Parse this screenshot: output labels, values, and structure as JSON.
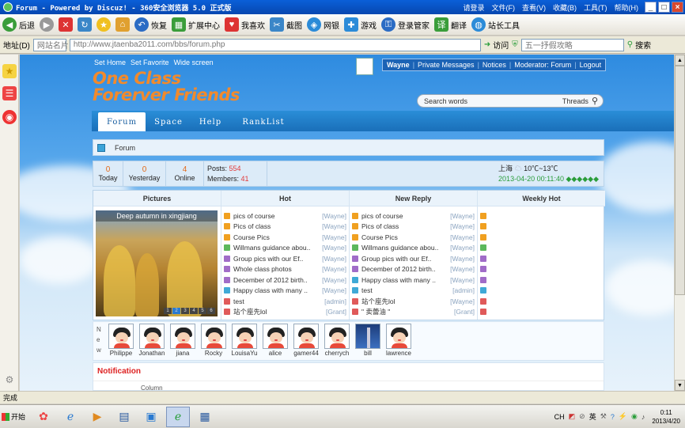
{
  "window": {
    "title": "Forum - Powered by Discuz! - 360安全浏览器 5.0 正式版",
    "menus": [
      "请登录",
      "文件(F)",
      "查看(V)",
      "收藏(B)",
      "工具(T)",
      "帮助(H)"
    ],
    "controls": {
      "minimize": "_",
      "maximize": "□",
      "close": "×"
    }
  },
  "toolbar": {
    "back": "后退",
    "restore": "恢复",
    "extensions": "扩展中心",
    "favorites_like": "我喜欢",
    "screenshot": "截图",
    "netbank": "网银",
    "games": "游戏",
    "login_manager": "登录管家",
    "translate": "翻译",
    "webmaster": "站长工具"
  },
  "address": {
    "label": "地址(D)",
    "site_name": "网站名片",
    "url": "http://www.jtaenba2011.com/bbs/forum.php",
    "go": "访问",
    "search_placeholder": "五一抒假攻略",
    "search_btn": "搜索"
  },
  "site": {
    "top_links": [
      "Set Home",
      "Set Favorite",
      "Wide screen"
    ],
    "brand_line1": "One Class",
    "brand_line2": "Forerver Friends",
    "user": {
      "name": "Wayne",
      "links": [
        "Private Messages",
        "Notices",
        "Moderator: Forum",
        "Logout"
      ]
    },
    "search": {
      "placeholder": "Search words",
      "scope": "Threads"
    },
    "nav": [
      "Forum",
      "Space",
      "Help",
      "RankList"
    ],
    "breadcrumb": "Forum"
  },
  "stats": {
    "today": {
      "value": "0",
      "label": "Today"
    },
    "yesterday": {
      "value": "0",
      "label": "Yesterday"
    },
    "online": {
      "value": "4",
      "label": "Online"
    },
    "posts_label": "Posts:",
    "posts": "554",
    "members_label": "Members:",
    "members": "41",
    "city": "上海",
    "temperature": "10℃~13℃",
    "datetime": "2013-04-20 00:11:40",
    "stars": "◆◆◆◆◆◆"
  },
  "columns": {
    "pictures": "Pictures",
    "hot": "Hot",
    "new_reply": "New Reply",
    "weekly_hot": "Weekly Hot"
  },
  "picture": {
    "caption": "Deep autumn in xingjiang",
    "pages": [
      "1",
      "2",
      "3",
      "4",
      "5",
      "6"
    ]
  },
  "hot": [
    {
      "title": "pics of course",
      "author": "[Wayne]",
      "color": "#f0a020"
    },
    {
      "title": "Pics of class",
      "author": "[Wayne]",
      "color": "#f0a020"
    },
    {
      "title": "Course Pics",
      "author": "[Wayne]",
      "color": "#f0a020"
    },
    {
      "title": "Willmans guidance abou..",
      "author": "[Wayne]",
      "color": "#5cb85c"
    },
    {
      "title": "Group pics with our Ef..",
      "author": "[Wayne]",
      "color": "#a06cc8"
    },
    {
      "title": "Whole class photos",
      "author": "[Wayne]",
      "color": "#a06cc8"
    },
    {
      "title": "December of 2012 birth..",
      "author": "[Wayne]",
      "color": "#a06cc8"
    },
    {
      "title": "Happy class with many ..",
      "author": "[Wayne]",
      "color": "#3fa9d6"
    },
    {
      "title": "test",
      "author": "[admin]",
      "color": "#e05a5a"
    },
    {
      "title": "站个座先lol",
      "author": "[Grant]",
      "color": "#e05a5a"
    }
  ],
  "new_reply": [
    {
      "title": "pics of course",
      "author": "[Wayne]",
      "color": "#f0a020"
    },
    {
      "title": "Pics of class",
      "author": "[Wayne]",
      "color": "#f0a020"
    },
    {
      "title": "Course Pics",
      "author": "[Wayne]",
      "color": "#f0a020"
    },
    {
      "title": "Willmans guidance abou..",
      "author": "[Wayne]",
      "color": "#5cb85c"
    },
    {
      "title": "Group pics with our Ef..",
      "author": "[Wayne]",
      "color": "#a06cc8"
    },
    {
      "title": "December of 2012 birth..",
      "author": "[Wayne]",
      "color": "#a06cc8"
    },
    {
      "title": "Happy class with many ..",
      "author": "[Wayne]",
      "color": "#3fa9d6"
    },
    {
      "title": "test",
      "author": "[admin]",
      "color": "#3fa9d6"
    },
    {
      "title": "站个座先lol",
      "author": "[Wayne]",
      "color": "#e05a5a"
    },
    {
      "title": "\" 卖蕾油 \"",
      "author": "[Grant]",
      "color": "#e05a5a"
    }
  ],
  "weekly_hot_colors": [
    "#f0a020",
    "#f0a020",
    "#f0a020",
    "#5cb85c",
    "#a06cc8",
    "#a06cc8",
    "#a06cc8",
    "#3fa9d6",
    "#e05a5a",
    "#e05a5a"
  ],
  "new_members": {
    "label": [
      "N",
      "e",
      "w"
    ],
    "list": [
      "Philippe",
      "Jonathan",
      "jiana",
      "Rocky",
      "LouisaYu",
      "alice",
      "gamer44",
      "cherrych",
      "bill",
      "lawrence"
    ]
  },
  "notification": {
    "title": "Notification",
    "column": "Column"
  },
  "status": {
    "text": "完成"
  },
  "taskbar": {
    "start": "开始",
    "tray": [
      "CH",
      "英"
    ],
    "clock_time": "0:11",
    "clock_date": "2013/4/20"
  }
}
